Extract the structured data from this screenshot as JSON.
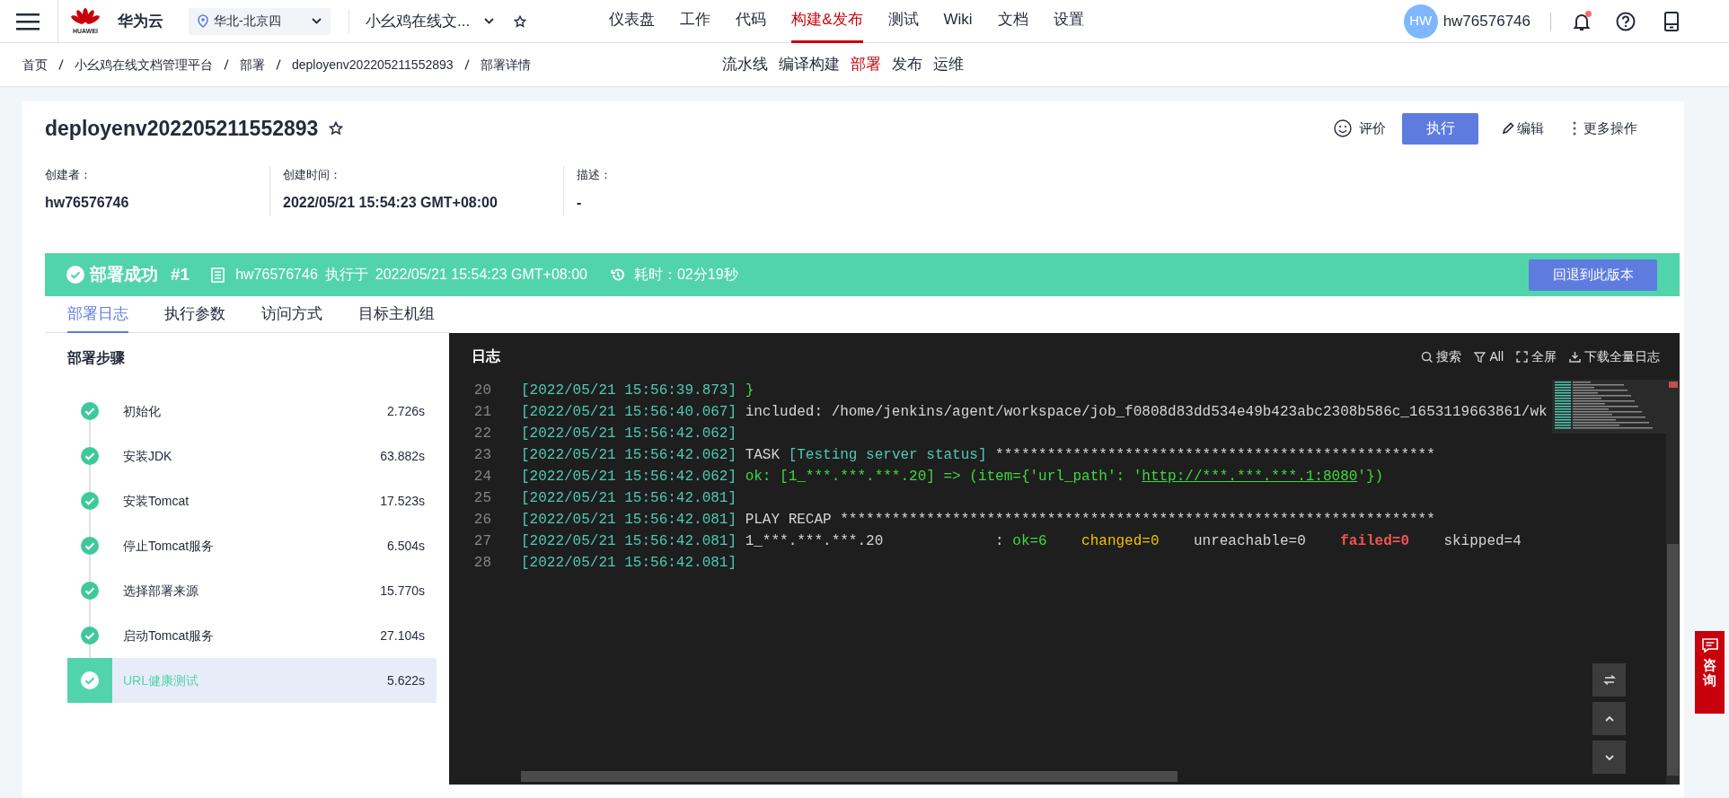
{
  "nav": {
    "logo_text": "华为云",
    "logo_caption": "HUAWEI",
    "region": "华北-北京四",
    "project": "小幺鸡在线文...",
    "notification_dot": true,
    "menu": [
      {
        "label": "仪表盘",
        "selected": false
      },
      {
        "label": "工作",
        "selected": false
      },
      {
        "label": "代码",
        "selected": false
      },
      {
        "label": "构建&发布",
        "selected": true
      },
      {
        "label": "测试",
        "selected": false
      },
      {
        "label": "Wiki",
        "selected": false
      },
      {
        "label": "文档",
        "selected": false
      },
      {
        "label": "设置",
        "selected": false
      }
    ],
    "user": {
      "initials": "HW",
      "name": "hw76576746"
    }
  },
  "breadcrumb": [
    "首页",
    "小幺鸡在线文档管理平台",
    "部署",
    "deployenv202205211552893",
    "部署详情"
  ],
  "subnav": [
    {
      "label": "流水线",
      "selected": false
    },
    {
      "label": "编译构建",
      "selected": false
    },
    {
      "label": "部署",
      "selected": true
    },
    {
      "label": "发布",
      "selected": false
    },
    {
      "label": "运维",
      "selected": false
    }
  ],
  "header": {
    "title": "deployenv202205211552893",
    "rate": "评价",
    "run": "执行",
    "edit": "编辑",
    "more": "更多操作"
  },
  "meta": [
    {
      "label": "创建者：",
      "value": "hw76576746"
    },
    {
      "label": "创建时间：",
      "value": "2022/05/21 15:54:23 GMT+08:00"
    },
    {
      "label": "描述：",
      "value": "-"
    }
  ],
  "banner": {
    "status": "部署成功",
    "run": "#1",
    "user": "hw76576746",
    "executed_label": "执行于",
    "time": "2022/05/21 15:54:23 GMT+08:00",
    "duration": "耗时：02分19秒",
    "rollback": "回退到此版本"
  },
  "tabs": [
    {
      "label": "部署日志",
      "selected": true
    },
    {
      "label": "执行参数",
      "selected": false
    },
    {
      "label": "访问方式",
      "selected": false
    },
    {
      "label": "目标主机组",
      "selected": false
    }
  ],
  "steps": {
    "title": "部署步骤",
    "items": [
      {
        "name": "初始化",
        "duration": "2.726s",
        "selected": false
      },
      {
        "name": "安装JDK",
        "duration": "63.882s",
        "selected": false
      },
      {
        "name": "安装Tomcat",
        "duration": "17.523s",
        "selected": false
      },
      {
        "name": "停止Tomcat服务",
        "duration": "6.504s",
        "selected": false
      },
      {
        "name": "选择部署来源",
        "duration": "15.770s",
        "selected": false
      },
      {
        "name": "启动Tomcat服务",
        "duration": "27.104s",
        "selected": false
      },
      {
        "name": "URL健康测试",
        "duration": "5.622s",
        "selected": true
      }
    ]
  },
  "log": {
    "title": "日志",
    "tools": [
      {
        "kind": "search",
        "label": "搜索"
      },
      {
        "kind": "filter",
        "label": "All"
      },
      {
        "kind": "fullscreen",
        "label": "全屏"
      },
      {
        "kind": "download",
        "label": "下载全量日志"
      }
    ],
    "lines": [
      {
        "number": "20",
        "time": "[2022/05/21 15:56:39.873]",
        "segments": [
          {
            "kind": "green",
            "text": "}"
          }
        ]
      },
      {
        "number": "21",
        "time": "[2022/05/21 15:56:40.067]",
        "segments": [
          {
            "kind": "plain",
            "text": "included: /home/jenkins/agent/workspace/job_f0808d83dd534e49b423abc2308b586c_1653119663861/wk"
          }
        ]
      },
      {
        "number": "22",
        "time": "[2022/05/21 15:56:42.062]"
      },
      {
        "number": "23",
        "time": "[2022/05/21 15:56:42.062]",
        "segments": [
          {
            "kind": "plain",
            "text": "TASK "
          },
          {
            "kind": "cyan",
            "text": "[Testing server status]"
          },
          {
            "kind": "plain",
            "text": " ***************************************************"
          }
        ]
      },
      {
        "number": "24",
        "time": "[2022/05/21 15:56:42.062]",
        "segments": [
          {
            "kind": "green",
            "text": "ok: [1_***.***.***.20] => (item={'url_path': '"
          },
          {
            "kind": "link",
            "text": "http://***.***.***.1:8080"
          },
          {
            "kind": "green",
            "text": "'})"
          }
        ]
      },
      {
        "number": "25",
        "time": "[2022/05/21 15:56:42.081]"
      },
      {
        "number": "26",
        "time": "[2022/05/21 15:56:42.081]",
        "segments": [
          {
            "kind": "plain",
            "text": "PLAY RECAP *********************************************************************"
          }
        ]
      },
      {
        "number": "27",
        "time": "[2022/05/21 15:56:42.081]",
        "segments": [
          {
            "kind": "plain",
            "text": "1_***.***.***.20             : "
          },
          {
            "kind": "green",
            "text": "ok=6"
          },
          {
            "kind": "yellow",
            "text": "    changed=0"
          },
          {
            "kind": "plain",
            "text": "    unreachable=0    "
          },
          {
            "kind": "red",
            "text": "failed=0"
          },
          {
            "kind": "plain",
            "text": "    skipped=4"
          }
        ]
      },
      {
        "number": "28",
        "time": "[2022/05/21 15:56:42.081]"
      }
    ]
  },
  "consult": "咨询"
}
